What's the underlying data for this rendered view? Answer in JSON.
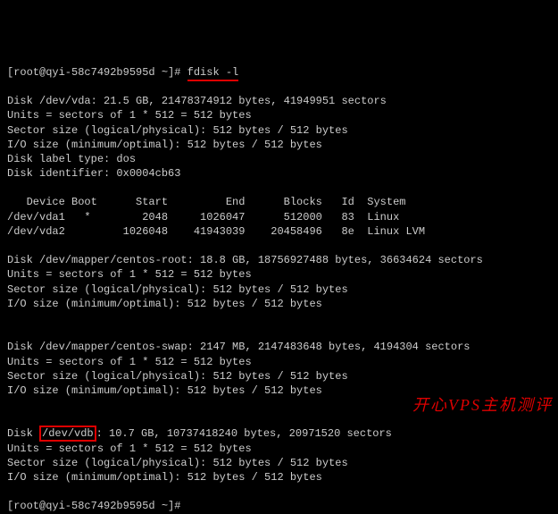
{
  "prompt1": "[root@qyi-58c7492b9595d ~]# ",
  "cmd": "fdisk -l",
  "vda": {
    "hdr": "Disk /dev/vda: 21.5 GB, 21478374912 bytes, 41949951 sectors",
    "units": "Units = sectors of 1 * 512 = 512 bytes",
    "sector": "Sector size (logical/physical): 512 bytes / 512 bytes",
    "io": "I/O size (minimum/optimal): 512 bytes / 512 bytes",
    "label": "Disk label type: dos",
    "ident": "Disk identifier: 0x0004cb63"
  },
  "tbl": {
    "hdr": "   Device Boot      Start         End      Blocks   Id  System",
    "r1": "/dev/vda1   *        2048     1026047      512000   83  Linux",
    "r2": "/dev/vda2         1026048    41943039    20458496   8e  Linux LVM"
  },
  "root": {
    "hdr": "Disk /dev/mapper/centos-root: 18.8 GB, 18756927488 bytes, 36634624 sectors",
    "units": "Units = sectors of 1 * 512 = 512 bytes",
    "sector": "Sector size (logical/physical): 512 bytes / 512 bytes",
    "io": "I/O size (minimum/optimal): 512 bytes / 512 bytes"
  },
  "swap": {
    "hdr": "Disk /dev/mapper/centos-swap: 2147 MB, 2147483648 bytes, 4194304 sectors",
    "units": "Units = sectors of 1 * 512 = 512 bytes",
    "sector": "Sector size (logical/physical): 512 bytes / 512 bytes",
    "io": "I/O size (minimum/optimal): 512 bytes / 512 bytes"
  },
  "vdb": {
    "pre": "Disk ",
    "dev": "/dev/vdb",
    "post": ": 10.7 GB, 10737418240 bytes, 20971520 sectors",
    "units": "Units = sectors of 1 * 512 = 512 bytes",
    "sector": "Sector size (logical/physical): 512 bytes / 512 bytes",
    "io": "I/O size (minimum/optimal): 512 bytes / 512 bytes"
  },
  "prompt2": "[root@qyi-58c7492b9595d ~]#",
  "watermark": "开心VPS主机测评"
}
